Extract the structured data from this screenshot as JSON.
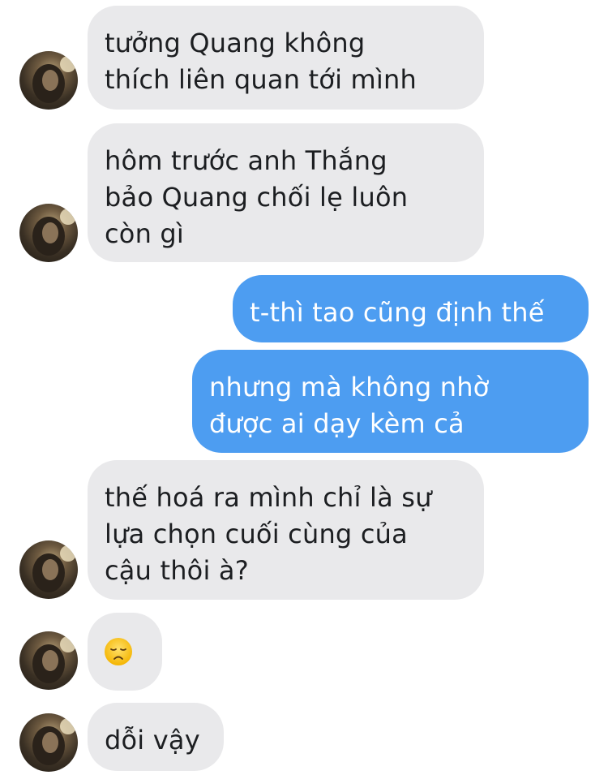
{
  "chat": {
    "messages": [
      {
        "side": "incoming",
        "text": "tưởng Quang không\nthích liên quan tới mình"
      },
      {
        "side": "incoming",
        "text": "hôm trước anh Thắng\nbảo Quang chối lẹ luôn\ncòn gì"
      },
      {
        "side": "outgoing",
        "text": "t-thì tao cũng định thế"
      },
      {
        "side": "outgoing",
        "text": "nhưng mà không nhờ\nđược ai dạy kèm cả"
      },
      {
        "side": "incoming",
        "text": "thế hoá ra mình chỉ là sự\nlựa chọn cuối cùng của\ncậu thôi à?"
      },
      {
        "side": "incoming",
        "emoji": "disappointed-face"
      },
      {
        "side": "incoming",
        "text": "dỗi vậy"
      }
    ]
  },
  "colors": {
    "incoming_bubble": "#e9e9eb",
    "outgoing_bubble": "#4d9df1",
    "incoming_text": "#1c1e21",
    "outgoing_text": "#ffffff"
  },
  "icons": {
    "avatar": "contact-avatar-photo",
    "emoji": "disappointed-face-emoji"
  }
}
